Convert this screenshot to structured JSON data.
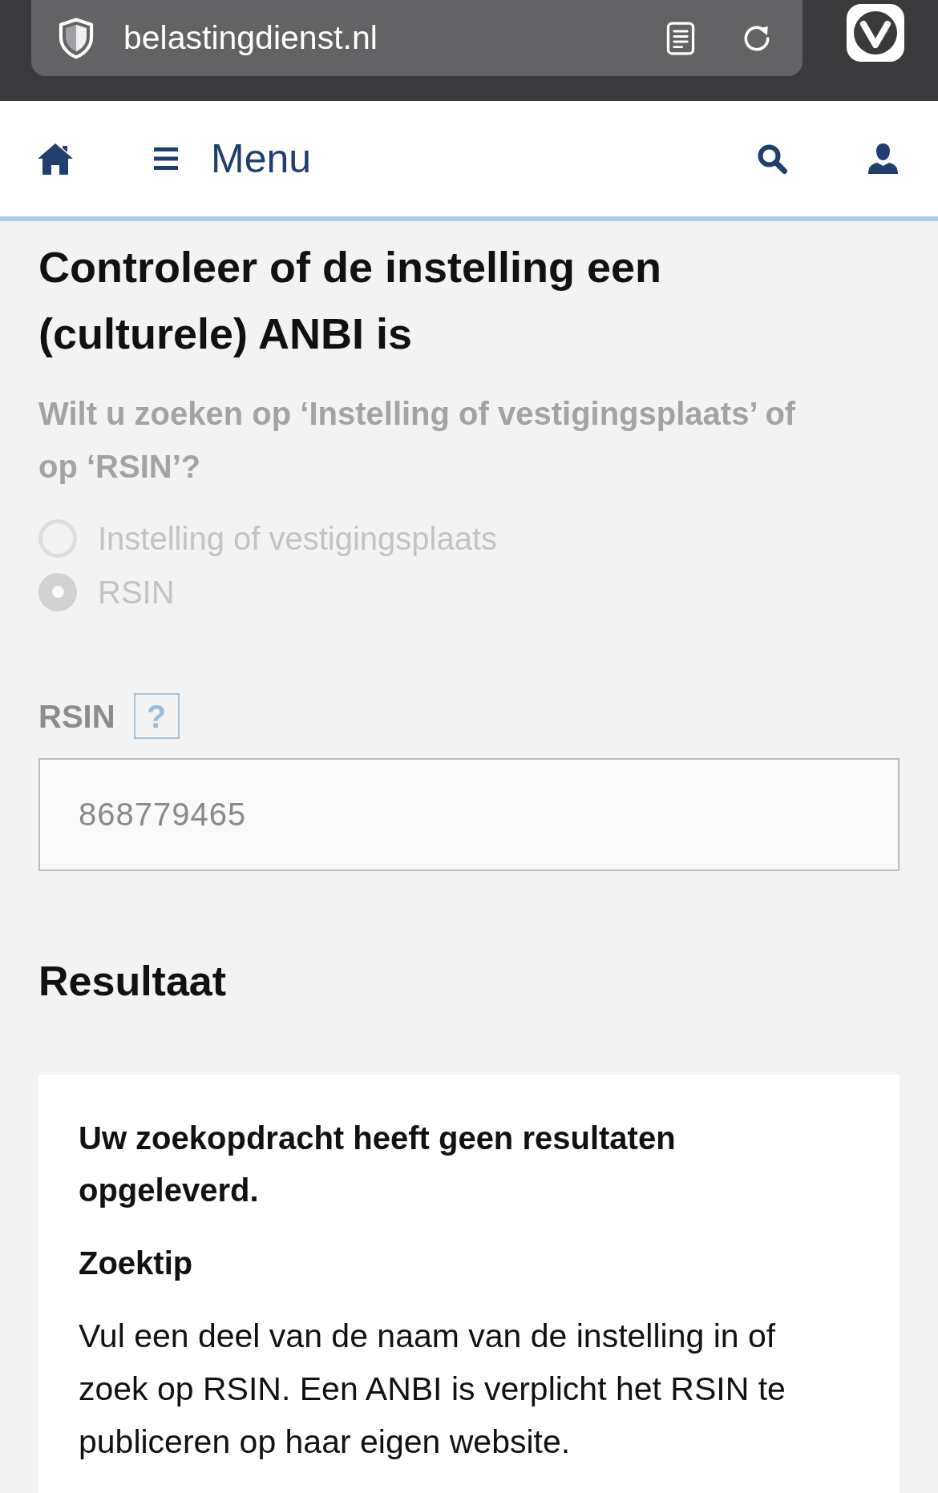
{
  "browser_bar": {
    "url": "belastingdienst.nl"
  },
  "nav": {
    "menu_label": "Menu"
  },
  "page": {
    "title": "Controleer of de instelling een (culturele) ANBI is"
  },
  "search_form": {
    "disabled": true,
    "question": "Wilt u zoeken op ‘Instelling of vestigingsplaats’ of op ‘RSIN’?",
    "options": [
      {
        "label": "Instelling of vestigingsplaats",
        "selected": false
      },
      {
        "label": "RSIN",
        "selected": true
      }
    ],
    "field": {
      "label": "RSIN",
      "help": "?",
      "value": "868779465"
    }
  },
  "result": {
    "heading": "Resultaat",
    "message": "Uw zoekopdracht heeft geen resultaten opgeleverd.",
    "tip_title": "Zoektip",
    "tip_text": "Vul een deel van de naam van de instelling in of zoek op RSIN. Een ANBI is verplicht het RSIN te publiceren op haar eigen website."
  }
}
